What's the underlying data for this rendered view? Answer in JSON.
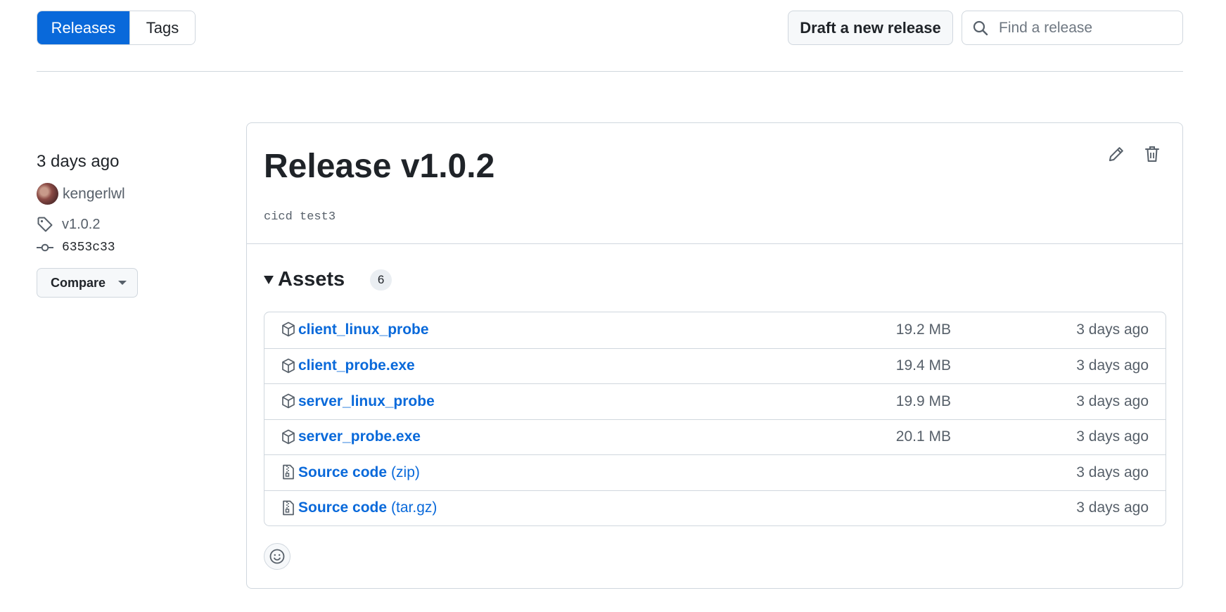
{
  "nav": {
    "releases_label": "Releases",
    "tags_label": "Tags",
    "draft_label": "Draft a new release",
    "search_placeholder": "Find a release"
  },
  "meta": {
    "date": "3 days ago",
    "author": "kengerlwl",
    "tag": "v1.0.2",
    "commit": "6353c33",
    "compare_label": "Compare"
  },
  "release": {
    "title": "Release v1.0.2",
    "body": "cicd test3"
  },
  "assets": {
    "label": "Assets",
    "count": "6",
    "items": [
      {
        "name": "client_linux_probe",
        "ext": "",
        "size": "19.2 MB",
        "date": "3 days ago",
        "icon": "package-icon"
      },
      {
        "name": "client_probe.exe",
        "ext": "",
        "size": "19.4 MB",
        "date": "3 days ago",
        "icon": "package-icon"
      },
      {
        "name": "server_linux_probe",
        "ext": "",
        "size": "19.9 MB",
        "date": "3 days ago",
        "icon": "package-icon"
      },
      {
        "name": "server_probe.exe",
        "ext": "",
        "size": "20.1 MB",
        "date": "3 days ago",
        "icon": "package-icon"
      },
      {
        "name": "Source code",
        "ext": "(zip)",
        "size": "",
        "date": "3 days ago",
        "icon": "file-zip-icon"
      },
      {
        "name": "Source code",
        "ext": "(tar.gz)",
        "size": "",
        "date": "3 days ago",
        "icon": "file-zip-icon"
      }
    ]
  },
  "colors": {
    "accent": "#0969da",
    "border": "#d0d7de",
    "muted": "#57606a"
  }
}
